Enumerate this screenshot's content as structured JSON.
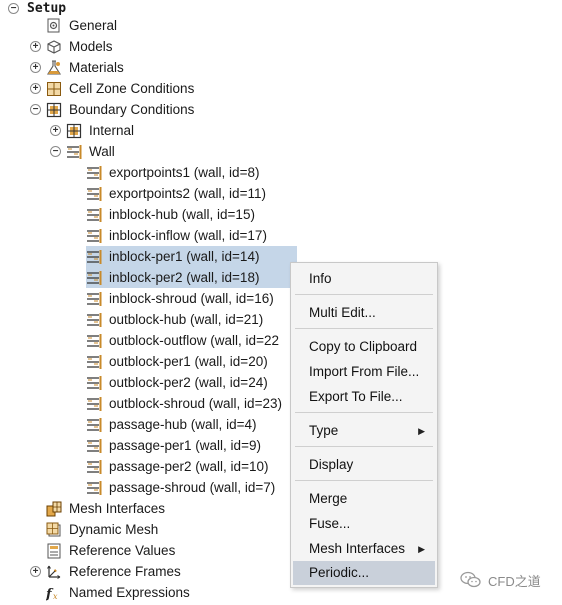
{
  "tree": {
    "setup": "Setup",
    "general": "General",
    "models": "Models",
    "materials": "Materials",
    "cell_zone": "Cell Zone Conditions",
    "boundary": "Boundary Conditions",
    "internal": "Internal",
    "wall": "Wall",
    "walls": [
      "exportpoints1 (wall, id=8)",
      "exportpoints2 (wall, id=11)",
      "inblock-hub (wall, id=15)",
      "inblock-inflow (wall, id=17)",
      "inblock-per1 (wall, id=14)",
      "inblock-per2 (wall, id=18)",
      "inblock-shroud (wall, id=16)",
      "outblock-hub (wall, id=21)",
      "outblock-outflow (wall, id=22",
      "outblock-per1 (wall, id=20)",
      "outblock-per2 (wall, id=24)",
      "outblock-shroud (wall, id=23)",
      "passage-hub (wall, id=4)",
      "passage-per1 (wall, id=9)",
      "passage-per2 (wall, id=10)",
      "passage-shroud (wall, id=7)"
    ],
    "mesh_interfaces": "Mesh Interfaces",
    "dynamic_mesh": "Dynamic Mesh",
    "reference_values": "Reference Values",
    "reference_frames": "Reference Frames",
    "named_expressions": "Named Expressions"
  },
  "menu": {
    "info": "Info",
    "multi_edit": "Multi Edit...",
    "copy": "Copy to Clipboard",
    "import": "Import From File...",
    "export": "Export To File...",
    "type": "Type",
    "display": "Display",
    "merge": "Merge",
    "fuse": "Fuse...",
    "mesh_interfaces": "Mesh Interfaces",
    "periodic": "Periodic..."
  },
  "watermark": "CFD之道",
  "colors": {
    "selection": "#c5d6e8",
    "menu_highlight": "#c9d0da",
    "wall_icon": "#c88a2a"
  }
}
